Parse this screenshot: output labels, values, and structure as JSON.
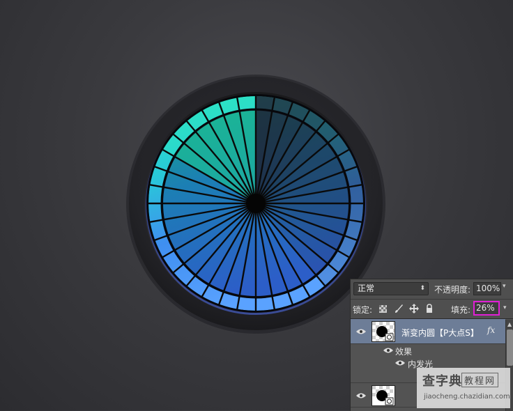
{
  "canvas": {
    "dial_segments": 36,
    "dial_colors": {
      "teal_light": "#2ee8c0",
      "teal": "#17b08a",
      "teal_dark": "#0d8f7a",
      "cyan": "#2fb8d4",
      "blue": "#3a72d9",
      "blue_light": "#5e9ff0",
      "navy": "#2a3a78",
      "dark": "#1e2233",
      "spoke": "#0a0a0a"
    },
    "highlight_segments": 6
  },
  "layers_panel": {
    "blend_mode": "正常",
    "opacity_label": "不透明度:",
    "opacity_value": "100%",
    "lock_label": "锁定:",
    "fill_label": "填充:",
    "fill_value": "26%",
    "highlight_color": "#e11fd6",
    "layers": [
      {
        "name": "渐变内圆【P大点S】",
        "fx": "fx",
        "selected": true
      },
      {
        "name": "",
        "fx": "",
        "selected": false
      }
    ],
    "effects_label": "效果",
    "inner_glow_label": "内发光"
  },
  "watermark": {
    "brand": "查字典",
    "section": "教程网",
    "url": "jiaocheng.chazidian.com"
  }
}
